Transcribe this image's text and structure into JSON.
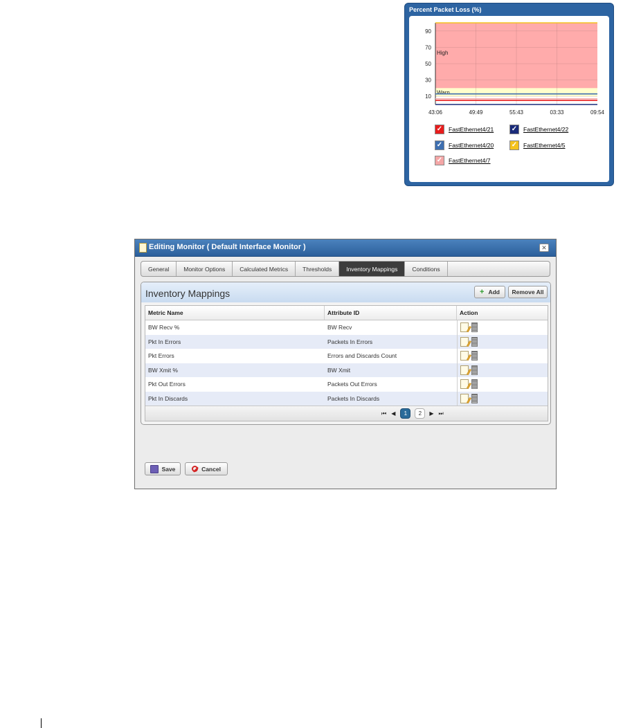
{
  "chart_panel": {
    "title": "Percent Packet Loss (%)",
    "zones": [
      {
        "label": "High",
        "from": 20,
        "to": 100,
        "color": "#ffabab"
      },
      {
        "label": "Warn",
        "from": 10,
        "to": 20,
        "color": "#ffffcc"
      }
    ],
    "legend": [
      {
        "label": "FastEthernet4/21",
        "color": "#e81c1c"
      },
      {
        "label": "FastEthernet4/22",
        "color": "#1a2b7a"
      },
      {
        "label": "FastEthernet4/20",
        "color": "#3e6fb0"
      },
      {
        "label": "FastEthernet4/5",
        "color": "#f4c21e"
      },
      {
        "label": "FastEthernet4/7",
        "color": "#f4a6a6"
      }
    ]
  },
  "chart_data": {
    "type": "line",
    "title": "Percent Packet Loss (%)",
    "xlabel": "",
    "ylabel": "",
    "x_ticks": [
      "43:06",
      "49:49",
      "55:43",
      "03:33",
      "09:54"
    ],
    "y_ticks": [
      10,
      30,
      50,
      70,
      90
    ],
    "ylim": [
      0,
      100
    ],
    "grid": true,
    "legend_position": "bottom",
    "series": [
      {
        "name": "FastEthernet4/21",
        "color": "#e81c1c",
        "values": [
          5,
          5,
          5,
          5,
          5
        ]
      },
      {
        "name": "FastEthernet4/22",
        "color": "#1a2b7a",
        "values": [
          0,
          0,
          0,
          0,
          0
        ]
      },
      {
        "name": "FastEthernet4/20",
        "color": "#3e6fb0",
        "values": [
          13,
          13,
          13,
          13,
          13
        ]
      },
      {
        "name": "FastEthernet4/5",
        "color": "#f4c21e",
        "values": [
          100,
          100,
          100,
          100,
          100
        ]
      },
      {
        "name": "FastEthernet4/7",
        "color": "#f4a6a6",
        "values": [
          7,
          7,
          7,
          7,
          7
        ]
      }
    ]
  },
  "dialog": {
    "title": "Editing Monitor ( Default Interface Monitor )",
    "close_label": "✕",
    "tabs": [
      "General",
      "Monitor Options",
      "Calculated Metrics",
      "Thresholds",
      "Inventory Mappings",
      "Conditions"
    ],
    "active_tab": "Inventory Mappings",
    "panel_title": "Inventory Mappings",
    "add_label": "Add",
    "remove_all_label": "Remove All",
    "columns": [
      "Metric Name",
      "Attribute ID",
      "Action"
    ],
    "rows": [
      {
        "metric": "BW Recv %",
        "attribute": "BW Recv"
      },
      {
        "metric": "Pkt In Errors",
        "attribute": "Packets In Errors"
      },
      {
        "metric": "Pkt Errors",
        "attribute": "Errors and Discards Count"
      },
      {
        "metric": "BW Xmit %",
        "attribute": "BW Xmit"
      },
      {
        "metric": "Pkt Out Errors",
        "attribute": "Packets Out Errors"
      },
      {
        "metric": "Pkt In Discards",
        "attribute": "Packets In Discards"
      }
    ],
    "pager": {
      "first": "⏮",
      "prev": "◀",
      "pages": [
        "1",
        "2"
      ],
      "current": "1",
      "next": "▶",
      "last": "⏭"
    },
    "save_label": "Save",
    "cancel_label": "Cancel"
  }
}
